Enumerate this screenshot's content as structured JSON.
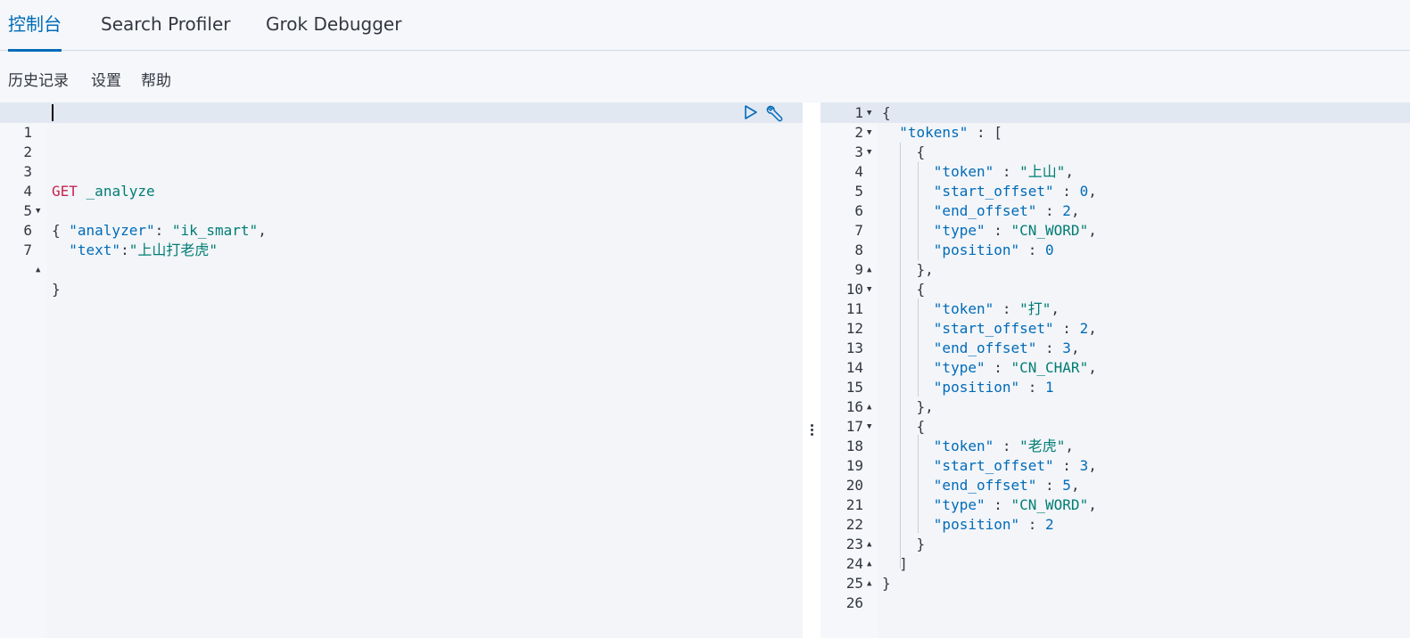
{
  "tabs": [
    {
      "label": "控制台",
      "active": true
    },
    {
      "label": "Search Profiler",
      "active": false
    },
    {
      "label": "Grok Debugger",
      "active": false
    }
  ],
  "menu": {
    "history": "历史记录",
    "settings": "设置",
    "help": "帮助"
  },
  "request_editor": {
    "lines": [
      {
        "n": "1",
        "text": ""
      },
      {
        "n": "2",
        "text": ""
      },
      {
        "n": "3",
        "method": "GET",
        "url": "_analyze"
      },
      {
        "n": "4",
        "text": "{"
      },
      {
        "n": "5",
        "key": "\"analyzer\"",
        "sep": ": ",
        "value": "\"ik_smart\"",
        "tail": ","
      },
      {
        "n": "6",
        "key": "\"text\"",
        "sep": ":",
        "value": "\"上山打老虎\"",
        "tail": ""
      },
      {
        "n": "7",
        "text": "}"
      }
    ],
    "actions": [
      "play-icon",
      "wrench-icon"
    ]
  },
  "response_editor": {
    "line_numbers": [
      "1",
      "2",
      "3",
      "4",
      "5",
      "6",
      "7",
      "8",
      "9",
      "10",
      "11",
      "12",
      "13",
      "14",
      "15",
      "16",
      "17",
      "18",
      "19",
      "20",
      "21",
      "22",
      "23",
      "24",
      "25",
      "26"
    ],
    "l1": "{",
    "l2_key": "\"tokens\"",
    "l2_rest": " : [",
    "l3": "{",
    "l4_key": "\"token\"",
    "l4_val": "\"上山\"",
    "l5_key": "\"start_offset\"",
    "l5_val": "0",
    "l6_key": "\"end_offset\"",
    "l6_val": "2",
    "l7_key": "\"type\"",
    "l7_val": "\"CN_WORD\"",
    "l8_key": "\"position\"",
    "l8_val": "0",
    "l9": "},",
    "l10": "{",
    "l11_key": "\"token\"",
    "l11_val": "\"打\"",
    "l12_key": "\"start_offset\"",
    "l12_val": "2",
    "l13_key": "\"end_offset\"",
    "l13_val": "3",
    "l14_key": "\"type\"",
    "l14_val": "\"CN_CHAR\"",
    "l15_key": "\"position\"",
    "l15_val": "1",
    "l16": "},",
    "l17": "{",
    "l18_key": "\"token\"",
    "l18_val": "\"老虎\"",
    "l19_key": "\"start_offset\"",
    "l19_val": "3",
    "l20_key": "\"end_offset\"",
    "l20_val": "5",
    "l21_key": "\"type\"",
    "l21_val": "\"CN_WORD\"",
    "l22_key": "\"position\"",
    "l22_val": "2",
    "l23": "}",
    "l24": "]",
    "l25": "}",
    "sep": " : ",
    "comma": ","
  },
  "colors": {
    "accent": "#006bb8",
    "method": "#c7254e",
    "string": "#017d73"
  }
}
